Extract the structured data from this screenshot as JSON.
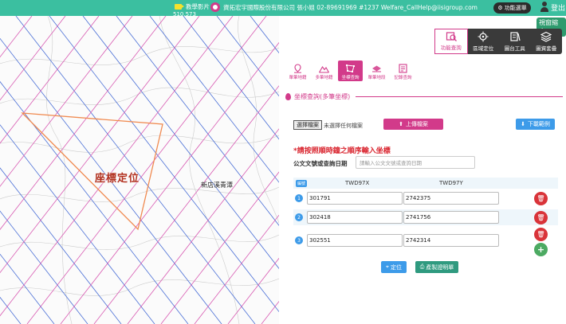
{
  "topbar": {
    "video_label": "教學影片",
    "company_text": "資拓宏宇國際股份有限公司 張小姐 02-89691969 #1237 Welfare_CallHelp@iisigroup.com",
    "counter": "510,573",
    "func_label": "功能選單",
    "login_label": "登出"
  },
  "map": {
    "locate_label": "座標定位",
    "place_label": "新店溪青潭",
    "pan_label": "視窗縮合"
  },
  "tools": [
    {
      "label": "功能查詢",
      "icon": "map-search-icon",
      "active": true
    },
    {
      "label": "區域定位",
      "icon": "target-icon",
      "active": false
    },
    {
      "label": "圖台工具",
      "icon": "toolbox-icon",
      "active": false
    },
    {
      "label": "圖資套疊",
      "icon": "layers-icon",
      "active": false
    }
  ],
  "subtabs": [
    {
      "label": "單筆地籍",
      "icon": "pin-icon",
      "active": false
    },
    {
      "label": "多筆地籍",
      "icon": "mountain-icon",
      "active": false
    },
    {
      "label": "坐標查詢",
      "icon": "polygon-icon",
      "active": true
    },
    {
      "label": "單筆地段",
      "icon": "land-icon",
      "active": false
    },
    {
      "label": "記錄查詢",
      "icon": "record-icon",
      "active": false
    }
  ],
  "section_title": "坐標查詢(多筆坐標)",
  "upload": {
    "choose_label": "選擇檔案",
    "no_file_label": "未選擇任何檔案",
    "upload_label": "上傳檔案",
    "download_label": "下載範例"
  },
  "warning": "*請按照順時鐘之順序輸入坐標",
  "doc": {
    "label": "公文文號或查詢日期",
    "placeholder": "請輸入公文文號或查詢日期"
  },
  "coords": {
    "num_header": "編號",
    "x_header": "TWD97X",
    "y_header": "TWD97Y",
    "rows": [
      {
        "n": "1",
        "x": "301791",
        "y": "2742375"
      },
      {
        "n": "2",
        "x": "302418",
        "y": "2741756"
      },
      {
        "n": "3",
        "x": "302551",
        "y": "2742314"
      }
    ]
  },
  "actions": {
    "locate_label": "定位",
    "print_label": "產製證明單"
  },
  "colors": {
    "teal": "#3bbfa0",
    "magenta": "#d23a8a",
    "blue": "#3d9be9",
    "red": "#d9343a",
    "green": "#4caa62"
  }
}
